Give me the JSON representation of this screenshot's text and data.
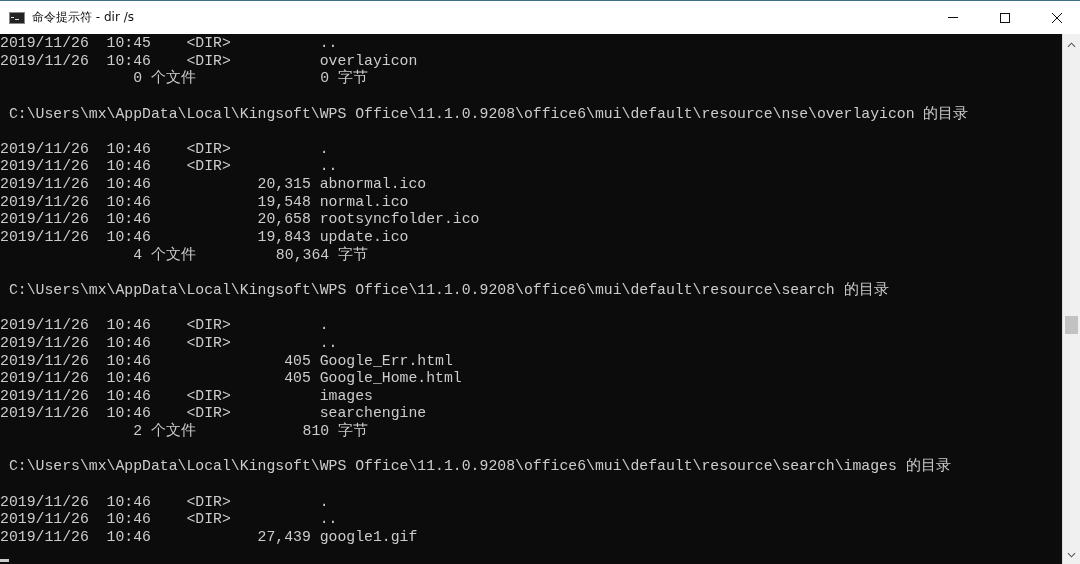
{
  "window": {
    "title": "命令提示符 - dir /s"
  },
  "console": {
    "lines": [
      {
        "kind": "text",
        "text": "2019/11/26  10:45    <DIR>          .."
      },
      {
        "kind": "text",
        "text": "2019/11/26  10:46    <DIR>          overlayicon"
      },
      {
        "kind": "text",
        "text": "               0 个文件              0 字节"
      },
      {
        "kind": "blank"
      },
      {
        "kind": "text",
        "text": " C:\\Users\\mx\\AppData\\Local\\Kingsoft\\WPS Office\\11.1.0.9208\\office6\\mui\\default\\resource\\nse\\overlayicon 的目录"
      },
      {
        "kind": "blank"
      },
      {
        "kind": "text",
        "text": "2019/11/26  10:46    <DIR>          ."
      },
      {
        "kind": "text",
        "text": "2019/11/26  10:46    <DIR>          .."
      },
      {
        "kind": "text",
        "text": "2019/11/26  10:46            20,315 abnormal.ico"
      },
      {
        "kind": "text",
        "text": "2019/11/26  10:46            19,548 normal.ico"
      },
      {
        "kind": "text",
        "text": "2019/11/26  10:46            20,658 rootsyncfolder.ico"
      },
      {
        "kind": "text",
        "text": "2019/11/26  10:46            19,843 update.ico"
      },
      {
        "kind": "text",
        "text": "               4 个文件         80,364 字节"
      },
      {
        "kind": "blank"
      },
      {
        "kind": "text",
        "text": " C:\\Users\\mx\\AppData\\Local\\Kingsoft\\WPS Office\\11.1.0.9208\\office6\\mui\\default\\resource\\search 的目录"
      },
      {
        "kind": "blank"
      },
      {
        "kind": "text",
        "text": "2019/11/26  10:46    <DIR>          ."
      },
      {
        "kind": "text",
        "text": "2019/11/26  10:46    <DIR>          .."
      },
      {
        "kind": "text",
        "text": "2019/11/26  10:46               405 Google_Err.html"
      },
      {
        "kind": "text",
        "text": "2019/11/26  10:46               405 Google_Home.html"
      },
      {
        "kind": "text",
        "text": "2019/11/26  10:46    <DIR>          images"
      },
      {
        "kind": "text",
        "text": "2019/11/26  10:46    <DIR>          searchengine"
      },
      {
        "kind": "text",
        "text": "               2 个文件            810 字节"
      },
      {
        "kind": "blank"
      },
      {
        "kind": "text",
        "text": " C:\\Users\\mx\\AppData\\Local\\Kingsoft\\WPS Office\\11.1.0.9208\\office6\\mui\\default\\resource\\search\\images 的目录"
      },
      {
        "kind": "blank"
      },
      {
        "kind": "text",
        "text": "2019/11/26  10:46    <DIR>          ."
      },
      {
        "kind": "text",
        "text": "2019/11/26  10:46    <DIR>          .."
      },
      {
        "kind": "text",
        "text": "2019/11/26  10:46            27,439 google1.gif"
      },
      {
        "kind": "cursor"
      }
    ]
  }
}
